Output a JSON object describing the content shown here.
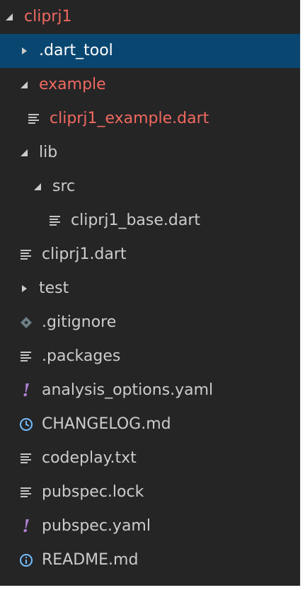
{
  "explorer": {
    "root": {
      "label": "cliprj1",
      "expanded": true,
      "git_status": "modified"
    },
    "items": [
      {
        "label": ".dart_tool",
        "kind": "folder",
        "expanded": false,
        "selected": true,
        "icon": "chevron-right-icon"
      },
      {
        "label": "example",
        "kind": "folder",
        "expanded": true,
        "git_status": "modified",
        "icon": "chevron-down-icon"
      },
      {
        "label": "cliprj1_example.dart",
        "kind": "file",
        "git_status": "modified",
        "icon": "lines-file-icon"
      },
      {
        "label": "lib",
        "kind": "folder",
        "expanded": true,
        "icon": "chevron-down-icon"
      },
      {
        "label": "src",
        "kind": "folder",
        "expanded": true,
        "icon": "chevron-down-icon"
      },
      {
        "label": "cliprj1_base.dart",
        "kind": "file",
        "icon": "lines-file-icon"
      },
      {
        "label": "cliprj1.dart",
        "kind": "file",
        "icon": "lines-file-icon"
      },
      {
        "label": "test",
        "kind": "folder",
        "expanded": false,
        "icon": "chevron-right-icon"
      },
      {
        "label": ".gitignore",
        "kind": "file",
        "icon": "git-diamond-icon"
      },
      {
        "label": ".packages",
        "kind": "file",
        "icon": "lines-file-icon"
      },
      {
        "label": "analysis_options.yaml",
        "kind": "file",
        "icon": "exclamation-icon",
        "icon_glyph": "!"
      },
      {
        "label": "CHANGELOG.md",
        "kind": "file",
        "icon": "clock-icon"
      },
      {
        "label": "codeplay.txt",
        "kind": "file",
        "icon": "lines-file-icon"
      },
      {
        "label": "pubspec.lock",
        "kind": "file",
        "icon": "lines-file-icon"
      },
      {
        "label": "pubspec.yaml",
        "kind": "file",
        "icon": "exclamation-icon",
        "icon_glyph": "!"
      },
      {
        "label": "README.md",
        "kind": "file",
        "icon": "info-icon"
      }
    ]
  },
  "colors": {
    "background": "#252526",
    "selection": "#094771",
    "text": "#cccccc",
    "git_modified": "#f0695f",
    "yaml_icon": "#b180d7",
    "info_icon": "#75beff",
    "file_icon": "#c5c5c5",
    "git_icon": "#6d8086"
  }
}
